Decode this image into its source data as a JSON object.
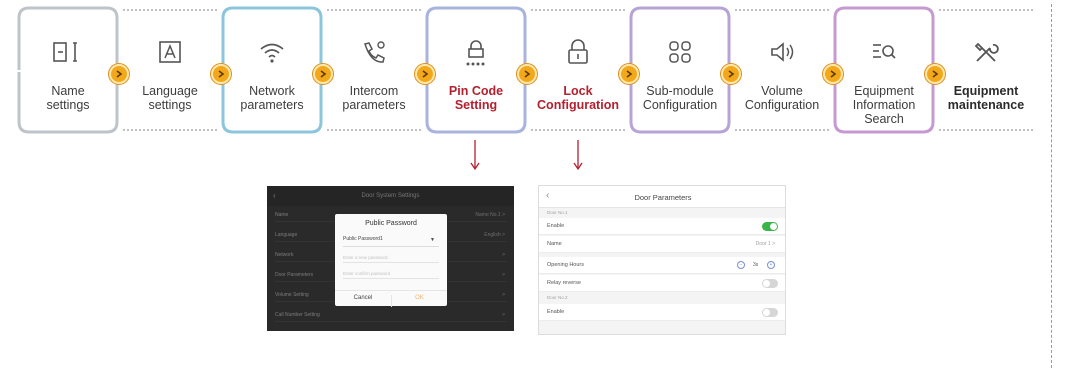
{
  "steps": [
    {
      "id": "name",
      "label_lines": [
        "Name",
        "settings"
      ],
      "icon": "text-cursor-icon",
      "color": "#bfc4ca",
      "emphasis": "normal"
    },
    {
      "id": "language",
      "label_lines": [
        "Language",
        "settings"
      ],
      "icon": "language-a-icon",
      "color": "#8cc6dc",
      "emphasis": "normal"
    },
    {
      "id": "network",
      "label_lines": [
        "Network",
        "parameters"
      ],
      "icon": "wifi-icon",
      "color": "#8cc6dc",
      "emphasis": "normal"
    },
    {
      "id": "intercom",
      "label_lines": [
        "Intercom",
        "parameters"
      ],
      "icon": "phone-settings-icon",
      "color": "#98b8dc",
      "emphasis": "normal"
    },
    {
      "id": "pin",
      "label_lines": [
        "Pin Code",
        "Setting"
      ],
      "icon": "pin-lock-icon",
      "color": "#a8b3de",
      "emphasis": "red"
    },
    {
      "id": "lock",
      "label_lines": [
        "Lock",
        "Configuration"
      ],
      "icon": "padlock-icon",
      "color": "#b2aedd",
      "emphasis": "red"
    },
    {
      "id": "submodule",
      "label_lines": [
        "Sub-module",
        "Configuration"
      ],
      "icon": "modules-grid-icon",
      "color": "#b8a3d6",
      "emphasis": "normal"
    },
    {
      "id": "volume",
      "label_lines": [
        "Volume",
        "Configuration"
      ],
      "icon": "speaker-icon",
      "color": "#c0a1d6",
      "emphasis": "normal"
    },
    {
      "id": "info",
      "label_lines": [
        "Equipment",
        "Information",
        "Search"
      ],
      "icon": "list-search-icon",
      "color": "#c59ad2",
      "emphasis": "normal"
    },
    {
      "id": "maintenance",
      "label_lines": [
        "Equipment",
        "maintenance"
      ],
      "icon": "tools-icon",
      "color": "#c98fd0",
      "emphasis": "bold"
    }
  ],
  "accent_colors": {
    "badge": "#f3a81b",
    "highlight_text": "#b3202e",
    "arrow": "#b3202e"
  },
  "dark_screen": {
    "title": "Door System Settings",
    "back_icon": "chevron-left-icon",
    "rows": [
      {
        "label": "Name",
        "value": "Name No.1 >"
      },
      {
        "label": "Language",
        "value": "English >"
      },
      {
        "label": "Network",
        "value": ">"
      },
      {
        "label": "Door Parameters",
        "value": ">"
      },
      {
        "label": "Volume Setting",
        "value": ">"
      },
      {
        "label": "Call Number Setting",
        "value": ">"
      }
    ],
    "dialog": {
      "title": "Public Password",
      "selected": "Public Password1",
      "input1_placeholder": "Enter a new password",
      "input2_placeholder": "Enter confirm password",
      "cancel": "Cancel",
      "ok": "OK"
    }
  },
  "light_screen": {
    "title": "Door Parameters",
    "back_icon": "chevron-left-icon",
    "group1": "Door No.1",
    "group2": "Door No.2",
    "rows": [
      {
        "label": "Enable",
        "kind": "toggle",
        "on": true
      },
      {
        "label": "Name",
        "kind": "value",
        "value": "Door 1 >"
      },
      {
        "label": "Opening Hours",
        "kind": "hours",
        "value": "3s"
      },
      {
        "label": "Relay reverse",
        "kind": "toggle",
        "on": false
      },
      {
        "label": "Enable",
        "kind": "toggle",
        "on": false
      }
    ]
  }
}
